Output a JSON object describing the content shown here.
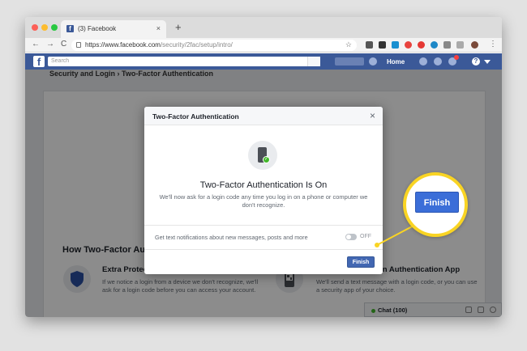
{
  "browser": {
    "tab_title": "(3) Facebook",
    "tab_close": "×",
    "new_tab": "+",
    "url_host": "https://www.facebook.com",
    "url_path": "/security/2fac/setup/intro/",
    "back": "←",
    "forward": "→",
    "reload": "C",
    "bookmark_star": "☆",
    "menu": "⋮"
  },
  "facebook": {
    "logo": "f",
    "search_placeholder": "Search",
    "home_label": "Home",
    "help_icon": "?",
    "breadcrumb": "Security and Login › Two-Factor Authentication",
    "section_title": "How Two-Factor Authentication Works",
    "features": [
      {
        "title": "Extra Protection",
        "text": "If we notice a login from a device we don't recognize, we'll ask for a login code before you can access your account."
      },
      {
        "title": "Through SMS or an Authentication App",
        "text": "We'll send a text message with a login code, or you can use a security app of your choice."
      }
    ],
    "chat_label": "Chat (100)"
  },
  "modal": {
    "title": "Two-Factor Authentication",
    "close": "×",
    "check": "✓",
    "heading": "Two-Factor Authentication Is On",
    "description": "We'll now ask for a login code any time you log in on a phone or computer we don't recognize.",
    "notifications_label": "Get text notifications about new messages, posts and more",
    "toggle_state": "OFF",
    "finish_button": "Finish"
  },
  "callout": {
    "finish_button": "Finish"
  },
  "colors": {
    "facebook_blue": "#3b5998",
    "button_blue": "#4267b2",
    "callout_yellow": "#f9d423"
  }
}
